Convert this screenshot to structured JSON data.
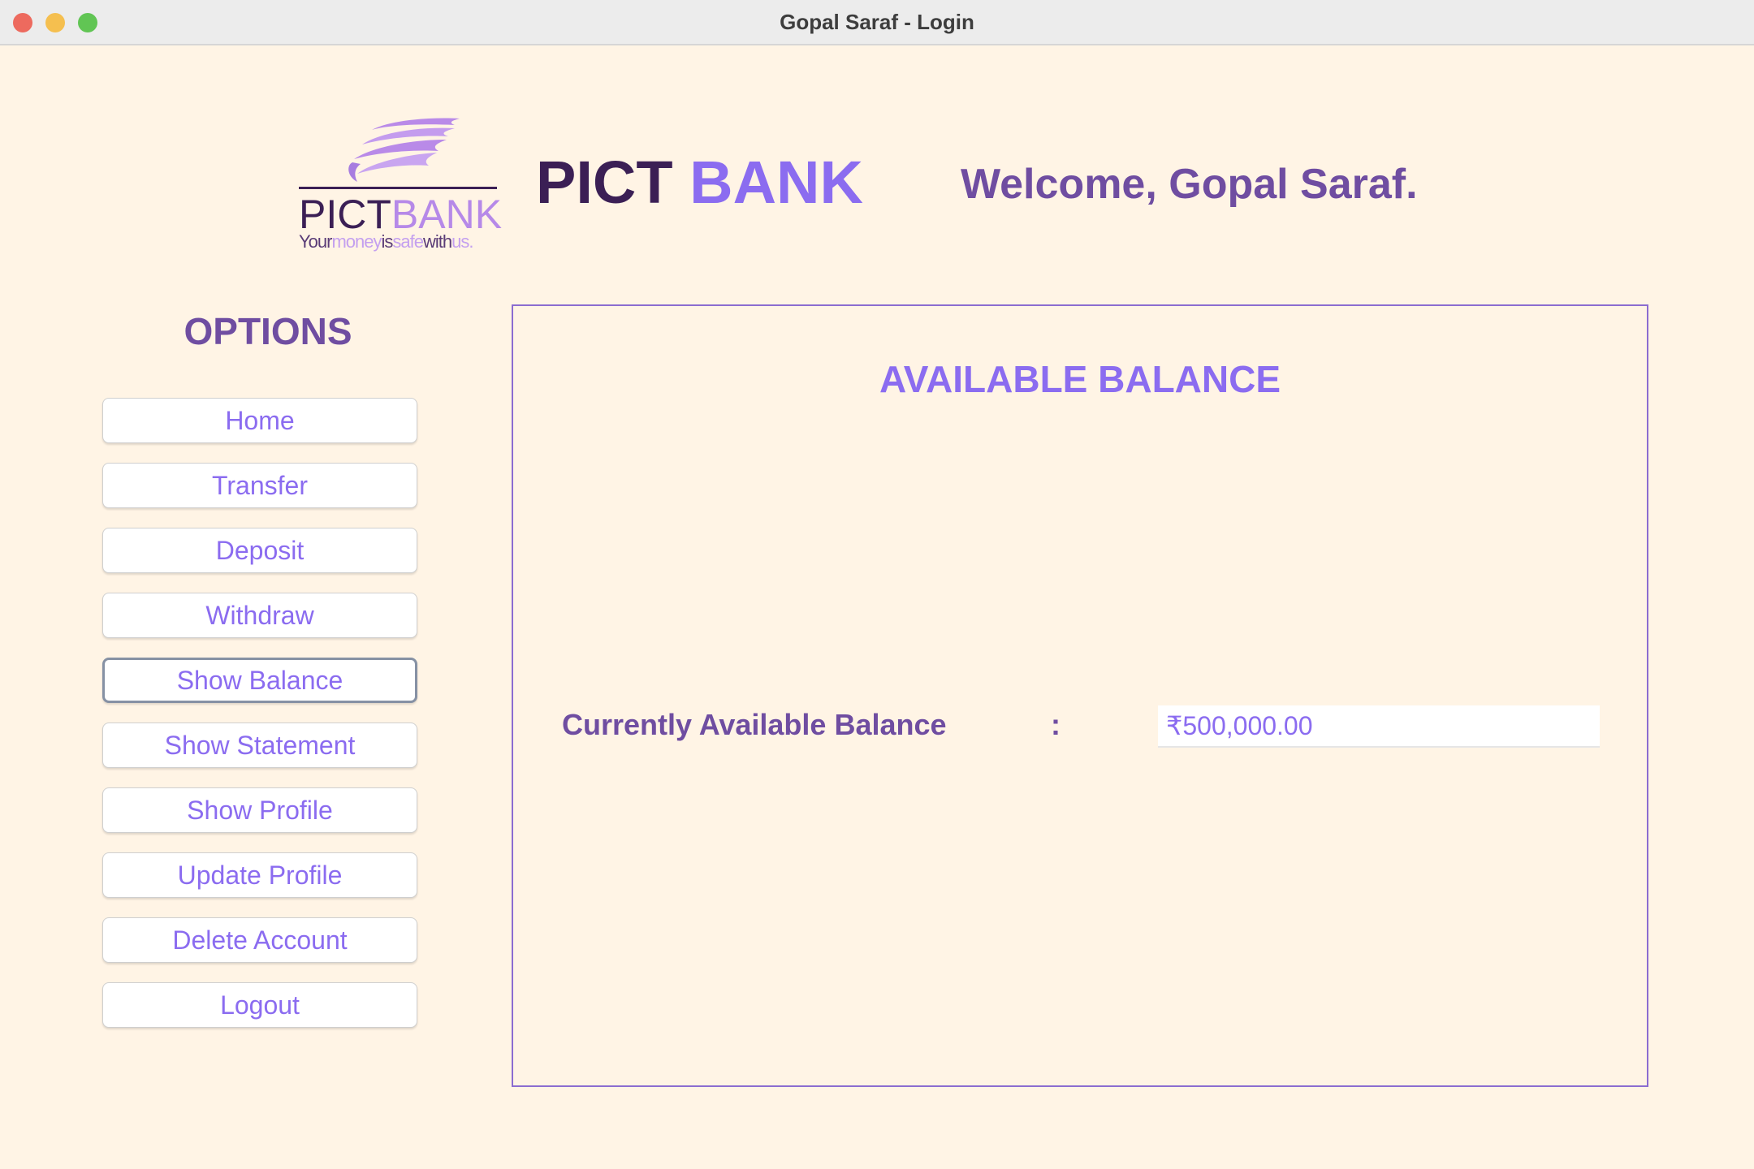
{
  "window": {
    "title": "Gopal Saraf - Login"
  },
  "logo": {
    "word_part1": "PICT",
    "word_part2": "BANK",
    "tagline": [
      {
        "text": "Your",
        "accent": false
      },
      {
        "text": "money",
        "accent": true
      },
      {
        "text": "is",
        "accent": false
      },
      {
        "text": "safe",
        "accent": true
      },
      {
        "text": "with",
        "accent": false
      },
      {
        "text": "us.",
        "accent": true
      }
    ]
  },
  "header": {
    "title_part1": "PICT",
    "title_part2": "BANK",
    "welcome": "Welcome, Gopal Saraf."
  },
  "sidebar": {
    "title": "OPTIONS",
    "items": [
      {
        "label": "Home",
        "active": false
      },
      {
        "label": "Transfer",
        "active": false
      },
      {
        "label": "Deposit",
        "active": false
      },
      {
        "label": "Withdraw",
        "active": false
      },
      {
        "label": "Show Balance",
        "active": true
      },
      {
        "label": "Show Statement",
        "active": false
      },
      {
        "label": "Show Profile",
        "active": false
      },
      {
        "label": "Update Profile",
        "active": false
      },
      {
        "label": "Delete Account",
        "active": false
      },
      {
        "label": "Logout",
        "active": false
      }
    ]
  },
  "main": {
    "title": "AVAILABLE BALANCE",
    "balance_label": "Currently Available Balance",
    "separator": ":",
    "balance_value": "₹500,000.00"
  },
  "colors": {
    "background": "#fff4e5",
    "dark_purple": "#3b1f55",
    "purple": "#6f4da1",
    "accent": "#8b6cf0",
    "logo_light": "#b689e8"
  }
}
